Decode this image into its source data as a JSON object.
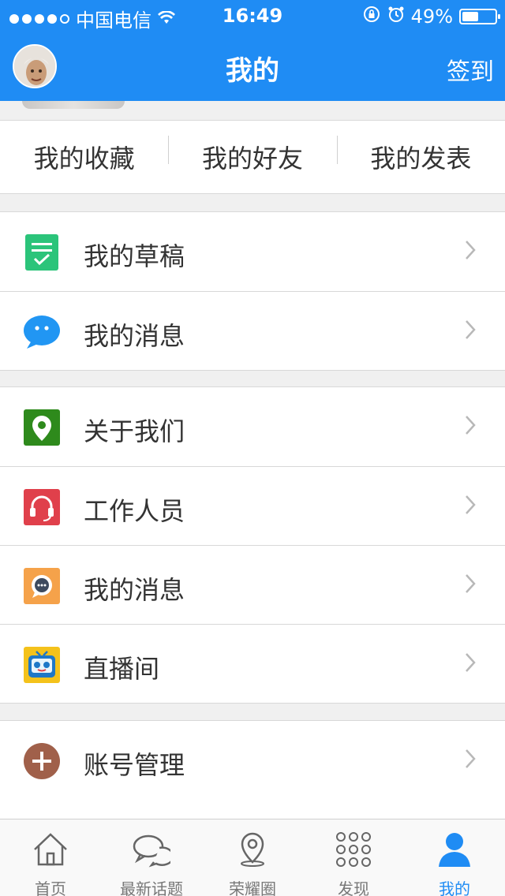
{
  "status_bar": {
    "carrier": "中国电信",
    "time": "16:49",
    "battery_text": "49%",
    "battery_level": 0.49
  },
  "nav": {
    "title": "我的",
    "right_action": "签到"
  },
  "quick_links": [
    {
      "label": "我的收藏"
    },
    {
      "label": "我的好友"
    },
    {
      "label": "我的发表"
    }
  ],
  "groups": [
    {
      "items": [
        {
          "label": "我的草稿",
          "icon": "draft-icon",
          "color": "#2bc47a"
        },
        {
          "label": "我的消息",
          "icon": "message-bubble-icon",
          "color": "#2196f3"
        }
      ]
    },
    {
      "items": [
        {
          "label": "关于我们",
          "icon": "location-pin-icon",
          "color": "#2e8a1c"
        },
        {
          "label": "工作人员",
          "icon": "headset-icon",
          "color": "#e0404b"
        },
        {
          "label": "我的消息",
          "icon": "chat-icon",
          "color": "#f5a24a"
        },
        {
          "label": "直播间",
          "icon": "tv-robot-icon",
          "color": "#f4c21b"
        }
      ]
    },
    {
      "items": [
        {
          "label": "账号管理",
          "icon": "plus-circle-icon",
          "color": "#a0604a"
        }
      ]
    }
  ],
  "tab_bar": [
    {
      "label": "首页",
      "icon": "home-icon"
    },
    {
      "label": "最新话题",
      "icon": "chat-bubbles-icon"
    },
    {
      "label": "荣耀圈",
      "icon": "map-pin-icon"
    },
    {
      "label": "发现",
      "icon": "grid-dots-icon"
    },
    {
      "label": "我的",
      "icon": "user-icon",
      "active": true
    }
  ],
  "colors": {
    "accent": "#1f8cf4",
    "background": "#f0f0f0"
  }
}
